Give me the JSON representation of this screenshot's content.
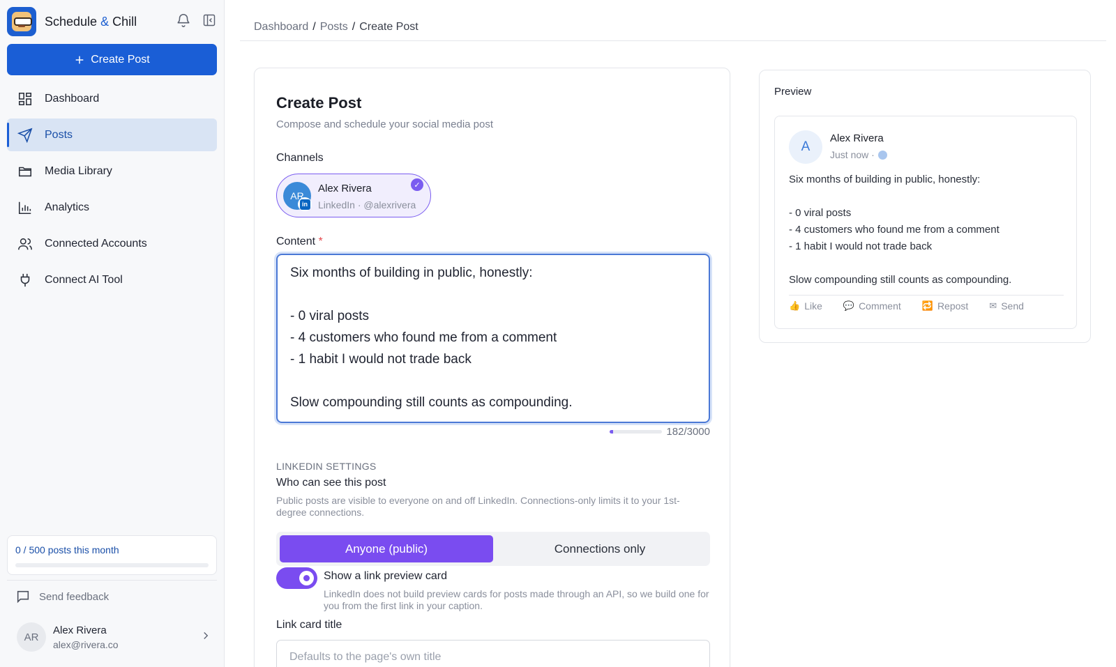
{
  "app": {
    "name_part1": "Schedule",
    "name_amp": "&",
    "name_part2": "Chill",
    "brand_color": "#1a5ed6",
    "accent_color": "#7a4cf0"
  },
  "sidebar": {
    "create_label": "Create Post",
    "items": [
      {
        "label": "Dashboard",
        "icon": "grid-icon"
      },
      {
        "label": "Posts",
        "icon": "send-icon",
        "active": true
      },
      {
        "label": "Media Library",
        "icon": "folder-icon"
      },
      {
        "label": "Analytics",
        "icon": "bar-chart-icon"
      },
      {
        "label": "Connected Accounts",
        "icon": "users-icon"
      },
      {
        "label": "Connect AI Tool",
        "icon": "plug-icon"
      }
    ],
    "quota_text": "0 / 500 posts this month",
    "quota_fraction": 0,
    "feedback_label": "Send feedback",
    "user": {
      "initials": "AR",
      "name": "Alex Rivera",
      "email": "alex@rivera.co"
    }
  },
  "breadcrumb": [
    "Dashboard",
    "Posts",
    "Create Post"
  ],
  "form": {
    "title": "Create Post",
    "subtitle": "Compose and schedule your social media post",
    "channels_label": "Channels",
    "channel": {
      "initials": "AR",
      "name": "Alex Rivera",
      "handle": "LinkedIn · @alexrivera",
      "network_badge": "in",
      "selected": true
    },
    "content_label": "Content",
    "required_mark": "*",
    "content": "Six months of building in public, honestly:\n\n- 0 viral posts\n- 4 customers who found me from a comment\n- 1 habit I would not trade back\n\nSlow compounding still counts as compounding.",
    "char_count": "182/3000",
    "char_fraction": 0.06,
    "section_heading": "LINKEDIN SETTINGS",
    "visibility_label": "Who can see this post",
    "visibility_help": "Public posts are visible to everyone on and off LinkedIn. Connections-only limits it to your 1st-degree connections.",
    "visibility_options": [
      "Anyone (public)",
      "Connections only"
    ],
    "visibility_selected": "Anyone (public)",
    "link_preview_label": "Show a link preview card",
    "link_preview_on": true,
    "link_preview_help": "LinkedIn does not build preview cards for posts made through an API, so we build one for you from the first link in your caption.",
    "link_title_label": "Link card title",
    "link_title_placeholder": "Defaults to the page's own title"
  },
  "preview": {
    "title": "Preview",
    "avatar_letter": "A",
    "name": "Alex Rivera",
    "time": "Just now ·",
    "body": "Six months of building in public, honestly:\n\n- 0 viral posts\n- 4 customers who found me from a comment\n- 1 habit I would not trade back\n\nSlow compounding still counts as compounding.",
    "actions": [
      "Like",
      "Comment",
      "Repost",
      "Send"
    ]
  }
}
